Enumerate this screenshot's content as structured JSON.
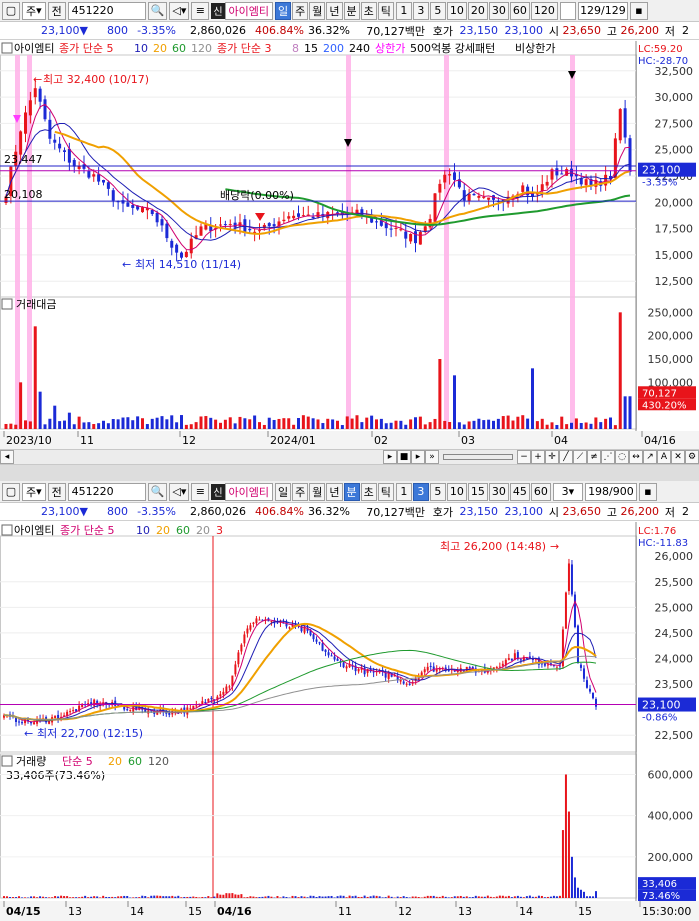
{
  "top": {
    "toolbar": {
      "type": "주",
      "prev": "전",
      "code": "451220",
      "sin": "신",
      "name": "아이엠티",
      "periods": [
        "일",
        "주",
        "월",
        "년",
        "분",
        "초",
        "틱"
      ],
      "active_period": "일",
      "ticks": [
        "1",
        "3",
        "5",
        "10",
        "20",
        "30",
        "60",
        "120"
      ],
      "count": "129/129"
    },
    "price": {
      "price": "23,100▼",
      "change": "800",
      "pct": "-3.35%",
      "volume": "2,860,026",
      "vol_ratio": "406.84%",
      "turnover": "36.32%",
      "amount": "70,127백만",
      "ho_label": "호가",
      "ask": "23,150",
      "bid": "23,100",
      "open_label": "시",
      "open": "23,650",
      "high_label": "고",
      "high": "26,200",
      "low_label": "저",
      "low": "2"
    },
    "legend": [
      "아이엠티",
      "종가 단순 5",
      "10",
      "20",
      "60",
      "120",
      "종가 단순 3",
      "8",
      "15",
      "200",
      "240",
      "상한가",
      "500억봉 강세패턴",
      "비상한가"
    ],
    "lc": "LC:59.20",
    "hc": "HC:-28.70",
    "high_ann": "최고 32,400 (10/17)",
    "low_ann": "최저 14,510 (11/14)",
    "div_ann": "배당락(0.00%)",
    "left_23447": "23,447",
    "left_20108": "20,108",
    "price_ticks": [
      "32,500",
      "30,000",
      "27,500",
      "25,000",
      "22,500",
      "20,000",
      "17,500",
      "15,000",
      "12,500"
    ],
    "cur_price": "23,100",
    "cur_pct": "-3.35%",
    "vol_title": "거래대금",
    "vol_ticks": [
      "250,000",
      "200,000",
      "150,000",
      "100,000",
      "50,000"
    ],
    "cur_vol": "70,127",
    "cur_vol_pct": "430.20%",
    "dates": [
      "2023/10",
      "11",
      "12",
      "2024/01",
      "02",
      "03",
      "04",
      "04/16"
    ]
  },
  "bottom": {
    "toolbar": {
      "type": "주",
      "prev": "전",
      "code": "451220",
      "sin": "신",
      "name": "아이엠티",
      "periods": [
        "일",
        "주",
        "월",
        "년",
        "분",
        "초",
        "틱"
      ],
      "active_period": "분",
      "ticks": [
        "1",
        "3",
        "5",
        "10",
        "15",
        "30",
        "45",
        "60"
      ],
      "active_tick": "3",
      "sel": "3",
      "count": "198/900"
    },
    "price": {
      "price": "23,100▼",
      "change": "800",
      "pct": "-3.35%",
      "volume": "2,860,026",
      "vol_ratio": "406.84%",
      "turnover": "36.32%",
      "amount": "70,127백만",
      "ho_label": "호가",
      "ask": "23,150",
      "bid": "23,100",
      "open_label": "시",
      "open": "23,650",
      "high_label": "고",
      "high": "26,200",
      "low_label": "저",
      "low": "2"
    },
    "legend": [
      "아이엠티",
      "종가 단순 5",
      "10",
      "20",
      "60",
      "20",
      "3"
    ],
    "lc": "LC:1.76",
    "hc": "HC:-11.83",
    "high_ann": "최고 26,200 (14:48)",
    "low_ann": "최저 22,700 (12:15)",
    "price_ticks": [
      "25,500",
      "25,000",
      "24,500",
      "24,000",
      "23,500",
      "22,500"
    ],
    "price_tick_top": "26,000",
    "cur_price": "23,100",
    "cur_pct": "-0.86%",
    "vol_title": "거래량",
    "vol_legend": [
      "단순 5",
      "20",
      "60",
      "120"
    ],
    "vol_sub": "33,406주(73.46%)",
    "vol_ticks": [
      "600,000",
      "400,000",
      "200,000"
    ],
    "cur_vol": "33,406",
    "cur_vol_pct": "73.46%",
    "times": [
      "04/15",
      "13",
      "14",
      "15",
      "04/16",
      "11",
      "12",
      "13",
      "14",
      "15",
      "15:30:00"
    ]
  },
  "colors": {
    "up": "#e8141b",
    "down": "#1b2ad6",
    "ma5": "#d0006f",
    "ma10": "#1e1eb4",
    "ma20": "#f0a000",
    "ma60": "#1f9a2e",
    "ma120": "#909090",
    "limit": "#ffb0e8",
    "pink_line": "#b400b4",
    "blue_line": "#2020c8"
  }
}
